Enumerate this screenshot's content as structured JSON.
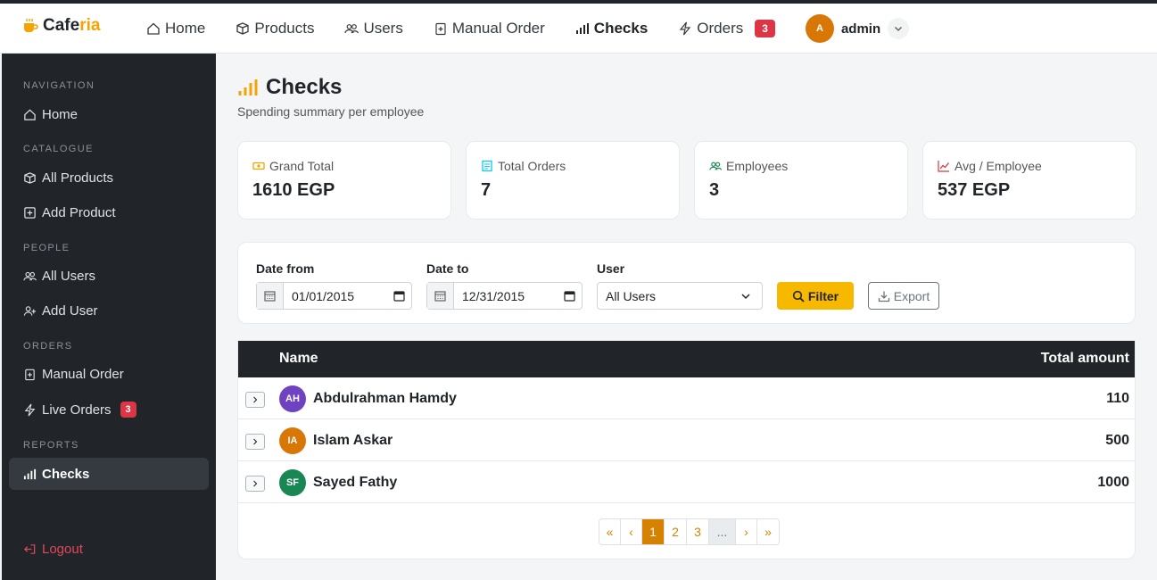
{
  "brand": {
    "name_prefix": "Cafe",
    "name_accent": "ria"
  },
  "topnav": {
    "home": "Home",
    "products": "Products",
    "users": "Users",
    "manual_order": "Manual Order",
    "checks": "Checks",
    "orders": "Orders",
    "orders_badge": "3",
    "user_initial": "A",
    "user_name": "admin"
  },
  "sidebar": {
    "sections": {
      "navigation": "NAVIGATION",
      "catalogue": "CATALOGUE",
      "people": "PEOPLE",
      "orders": "ORDERS",
      "reports": "REPORTS"
    },
    "items": {
      "home": "Home",
      "all_products": "All Products",
      "add_product": "Add Product",
      "all_users": "All Users",
      "add_user": "Add User",
      "manual_order": "Manual Order",
      "live_orders": "Live Orders",
      "live_orders_badge": "3",
      "checks": "Checks",
      "logout": "Logout"
    }
  },
  "page": {
    "title": "Checks",
    "subtitle": "Spending summary per employee"
  },
  "stats": [
    {
      "label": "Grand Total",
      "value": "1610 EGP",
      "icon": "cash-icon"
    },
    {
      "label": "Total Orders",
      "value": "7",
      "icon": "receipt-icon"
    },
    {
      "label": "Employees",
      "value": "3",
      "icon": "people-icon"
    },
    {
      "label": "Avg / Employee",
      "value": "537 EGP",
      "icon": "graph-up-icon"
    }
  ],
  "filters": {
    "date_from_label": "Date from",
    "date_from_value": "01/01/2015",
    "date_to_label": "Date to",
    "date_to_value": "12/31/2015",
    "user_label": "User",
    "user_value": "All Users",
    "filter_button": "Filter",
    "export_button": "Export"
  },
  "table": {
    "columns": {
      "name": "Name",
      "amount": "Total amount"
    },
    "rows": [
      {
        "initials": "AH",
        "name": "Abdulrahman Hamdy",
        "amount": "110",
        "color": "#6f42c1"
      },
      {
        "initials": "IA",
        "name": "Islam Askar",
        "amount": "500",
        "color": "#d97706"
      },
      {
        "initials": "SF",
        "name": "Sayed Fathy",
        "amount": "1000",
        "color": "#198754"
      }
    ]
  },
  "pagination": {
    "first": "«",
    "prev": "‹",
    "pages": [
      "1",
      "2",
      "3"
    ],
    "ellipsis": "...",
    "next": "›",
    "last": "»",
    "current": "1"
  },
  "colors": {
    "accent": "#f7b900",
    "sidebar_bg": "#212529",
    "danger": "#dc3545"
  }
}
